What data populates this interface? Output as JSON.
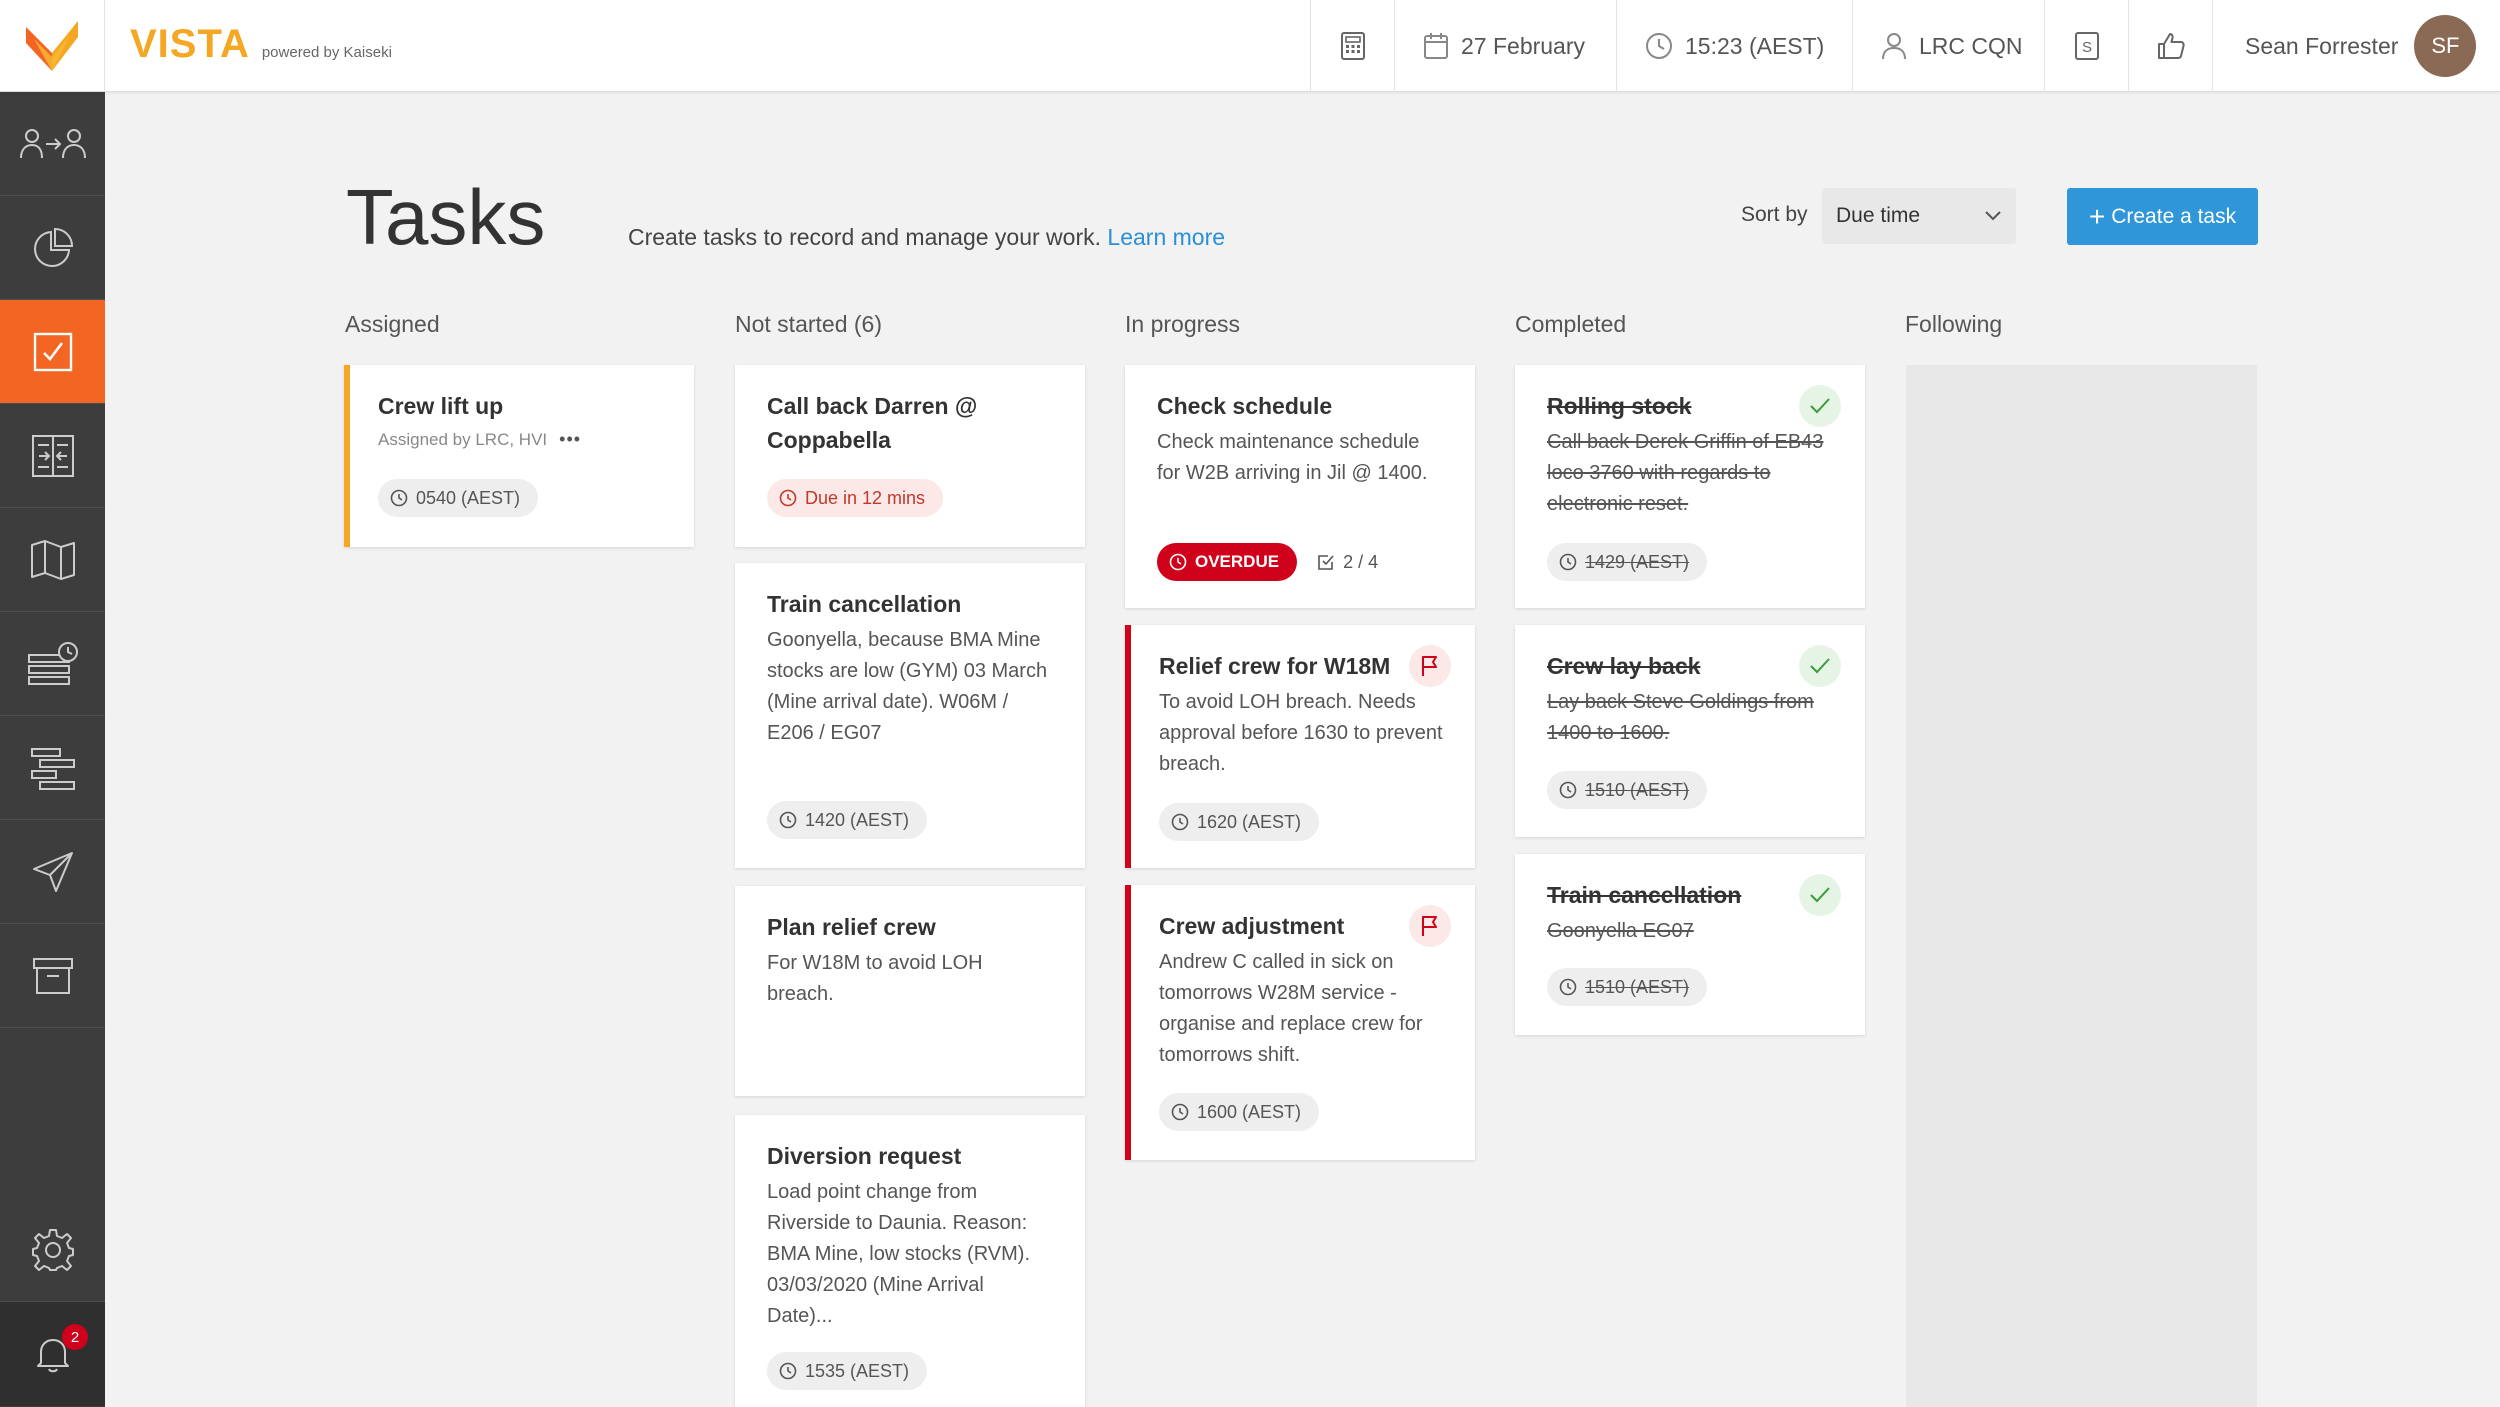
{
  "brand": {
    "name": "VISTA",
    "tagline": "powered by Kaiseki"
  },
  "topbar": {
    "date": "27 February",
    "time": "15:23 (AEST)",
    "location": "LRC CQN",
    "user_name": "Sean Forrester",
    "user_initials": "SF"
  },
  "sidebar": {
    "items": [
      {
        "icon": "crew-transfer-icon"
      },
      {
        "icon": "pie-chart-icon"
      },
      {
        "icon": "tasks-icon",
        "active": true
      },
      {
        "icon": "compare-list-icon"
      },
      {
        "icon": "map-icon"
      },
      {
        "icon": "schedule-list-icon"
      },
      {
        "icon": "gantt-icon"
      },
      {
        "icon": "send-icon"
      },
      {
        "icon": "archive-icon"
      },
      {
        "icon": "gear-icon"
      },
      {
        "icon": "bell-icon"
      }
    ],
    "notification_count": "2"
  },
  "header": {
    "title": "Tasks",
    "description": "Create tasks to record and manage your work.",
    "learn_more": "Learn more",
    "sort_label": "Sort by",
    "sort_value": "Due time",
    "create_button": "Create a task"
  },
  "columns": {
    "assigned": {
      "title": "Assigned",
      "cards": [
        {
          "title": "Crew lift up",
          "meta": "Assigned by LRC, HVI",
          "more": "•••",
          "chip": "0540 (AEST)"
        }
      ]
    },
    "not_started": {
      "title": "Not started (6)",
      "cards": [
        {
          "title": "Call back Darren @ Coppabella",
          "chip": "Due in 12 mins"
        },
        {
          "title": "Train cancellation",
          "body": "Goonyella, because BMA Mine stocks are low (GYM) 03 March (Mine arrival date). W06M / E206 / EG07",
          "chip": "1420 (AEST)"
        },
        {
          "title": "Plan relief crew",
          "body": "For W18M to avoid LOH breach."
        },
        {
          "title": "Diversion request",
          "body": "Load point change from Riverside to Daunia. Reason: BMA Mine, low stocks (RVM). 03/03/2020 (Mine Arrival Date)...",
          "chip": "1535 (AEST)"
        }
      ]
    },
    "in_progress": {
      "title": "In progress",
      "cards": [
        {
          "title": "Check schedule",
          "body": "Check maintenance schedule for W2B arriving in Jil @ 1400.",
          "chip": "OVERDUE",
          "subtasks": "2 / 4"
        },
        {
          "title": "Relief crew for W18M",
          "body": "To avoid LOH breach. Needs approval before 1630 to prevent breach.",
          "chip": "1620 (AEST)"
        },
        {
          "title": "Crew adjustment",
          "body": "Andrew C called in sick on tomorrows W28M service - organise and replace crew for tomorrows shift.",
          "chip": "1600 (AEST)"
        }
      ]
    },
    "completed": {
      "title": "Completed",
      "cards": [
        {
          "title": "Rolling stock",
          "body": "Call back Derek Griffin of EB43 loco 3760 with regards to electronic reset.",
          "chip": "1429 (AEST)"
        },
        {
          "title": "Crew lay back",
          "body": "Lay back Steve Goldings from 1400 to 1600.",
          "chip": "1510 (AEST)"
        },
        {
          "title": "Train cancellation",
          "body": "Goonyella EG07",
          "chip": "1510 (AEST)"
        }
      ]
    },
    "following": {
      "title": "Following"
    }
  },
  "colors": {
    "accent": "#f26522",
    "brand": "#f5a623",
    "primary": "#2f97d9",
    "danger": "#d0021b"
  }
}
